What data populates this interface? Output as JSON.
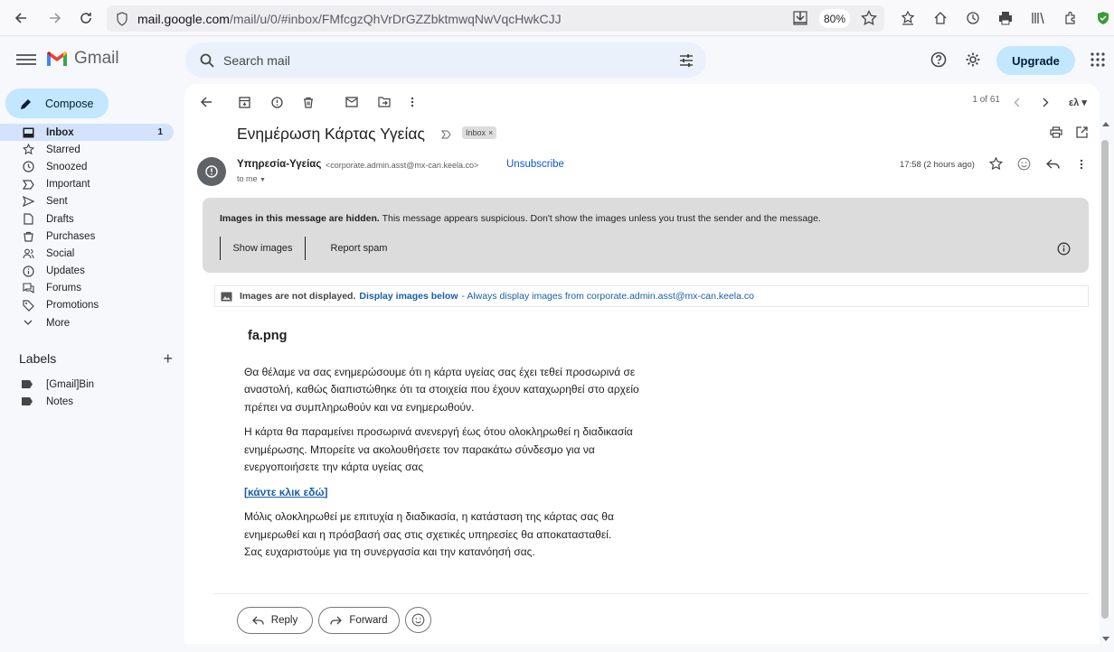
{
  "browser": {
    "url_host": "mail.google.com",
    "url_path": "/mail/u/0/#inbox/FMfcgzQhVrDrGZZbktmwqNwVqcHwkCJJ",
    "zoom": "80%"
  },
  "header": {
    "logo_text": "Gmail",
    "search_placeholder": "Search mail",
    "upgrade_label": "Upgrade"
  },
  "sidebar": {
    "compose_label": "Compose",
    "items": [
      {
        "label": "Inbox",
        "count": "1",
        "icon": "inbox-icon"
      },
      {
        "label": "Starred",
        "icon": "star-icon"
      },
      {
        "label": "Snoozed",
        "icon": "clock-icon"
      },
      {
        "label": "Important",
        "icon": "important-icon"
      },
      {
        "label": "Sent",
        "icon": "send-icon"
      },
      {
        "label": "Drafts",
        "icon": "draft-icon"
      },
      {
        "label": "Purchases",
        "icon": "cart-icon"
      },
      {
        "label": "Social",
        "icon": "people-icon"
      },
      {
        "label": "Updates",
        "icon": "info-icon"
      },
      {
        "label": "Forums",
        "icon": "forum-icon"
      },
      {
        "label": "Promotions",
        "icon": "tag-icon"
      },
      {
        "label": "More",
        "icon": "chevron-down-icon"
      }
    ],
    "labels_title": "Labels",
    "labels": [
      "[Gmail]Bin",
      "Notes"
    ]
  },
  "message": {
    "pager": "1 of 61",
    "subject": "Ενημέρωση Κάρτας Υγείας",
    "inbox_chip": "Inbox",
    "sender_name": "Υπηρεσία-Υγείας",
    "sender_email": "<corporate.admin.asst@mx-can.keela.co>",
    "unsubscribe": "Unsubscribe",
    "to": "to me",
    "time": "17:58 (2 hours ago)",
    "warning_bold": "Images in this message are hidden.",
    "warning_text": "This message appears suspicious. Don't show the images unless you trust the sender and the message.",
    "show_images": "Show images",
    "report_spam": "Report spam",
    "imgbar_bold": "Images are not displayed.",
    "imgbar_link": "Display images below",
    "imgbar_link2": "- Always display images from corporate.admin.asst@mx-can.keela.co",
    "file_name": "fa.png",
    "para1": "Θα θέλαμε να σας ενημερώσουμε ότι η κάρτα υγείας σας έχει τεθεί προσωρινά σε αναστολή, καθώς διαπιστώθηκε ότι τα στοιχεία που έχουν καταχωρηθεί στο αρχείο πρέπει να συμπληρωθούν και να ενημερωθούν.",
    "para2": "Η κάρτα θα παραμείνει προσωρινά ανενεργή έως ότου ολοκληρωθεί η διαδικασία ενημέρωσης. Μπορείτε να ακολουθήσετε τον παρακάτω σύνδεσμο για να ενεργοποιήσετε την κάρτα υγείας σας",
    "link": "[κάντε κλικ εδώ]",
    "para3": "Μόλις ολοκληρωθεί με επιτυχία η διαδικασία, η κατάσταση της κάρτας σας θα ενημερωθεί και η πρόσβασή σας στις σχετικές υπηρεσίες θα αποκατασταθεί.",
    "para4": "Σας ευχαριστούμε για τη συνεργασία και την κατανόησή σας.",
    "reply": "Reply",
    "forward": "Forward"
  }
}
